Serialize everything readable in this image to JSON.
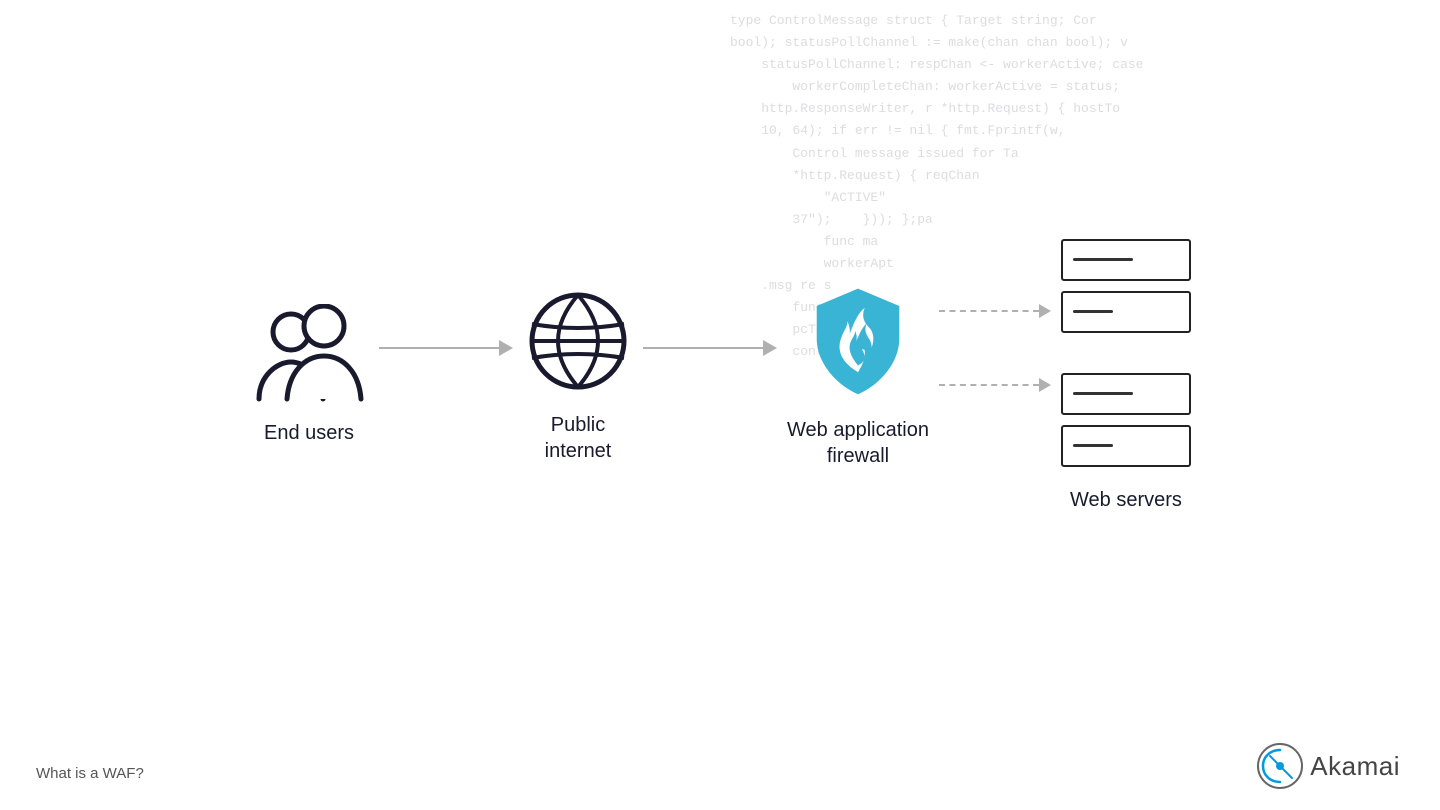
{
  "code_lines": [
    "type ControlMessage struct { Target string; Cor",
    "bool); statusPollChannel := make(chan chan bool); v",
    "    statusPollChannel: respChan <- workerActive; case",
    "        workerCompleteChan: workerActive = status;",
    "    http.ResponseWriter, r *http.Request) { hostTo",
    "    10, 64); if err != nil { fmt.Fprintf(w,",
    "        Control message issued for Ta",
    "        *http.Request) { reqChan",
    "            \"ACTIVE\"",
    "        37\");    })); };pa",
    "            func ma",
    "            workerApt",
    "    .msg re s",
    "        func admin(t",
    "        pcToken",
    "        contentWri"
  ],
  "nodes": {
    "end_users": {
      "label": "End users"
    },
    "public_internet": {
      "label": "Public\ninternet"
    },
    "waf": {
      "label": "Web application\nfirewall"
    },
    "web_servers": {
      "label": "Web servers"
    }
  },
  "bottom": {
    "what_is_waf": "What is a WAF?",
    "akamai": "Akamai"
  }
}
